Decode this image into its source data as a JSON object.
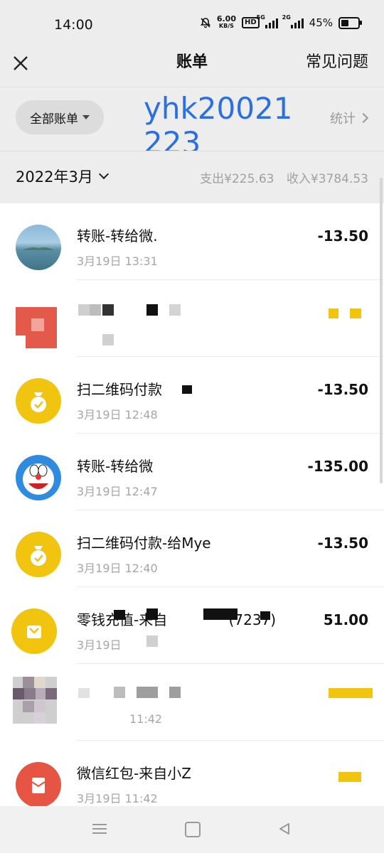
{
  "status": {
    "time": "14:00",
    "speed_value": "6.00",
    "speed_unit": "KB/S",
    "hd": "HD",
    "net1": "5G",
    "net2": "2G",
    "battery": "45%",
    "battery_level": 0.45
  },
  "nav": {
    "title": "账单",
    "faq": "常见问题",
    "close_icon": "close-icon"
  },
  "filter": {
    "all_bills": "全部账单",
    "watermark_line1": "yhk20021",
    "watermark_line2": "223",
    "stats": "统计"
  },
  "month": {
    "label": "2022年3月",
    "expense": "支出¥225.63",
    "income": "收入¥3784.53"
  },
  "transactions": [
    {
      "title": "转账-转给微.",
      "time": "3月19日 13:31",
      "amount": "-13.50",
      "avatar": "sea-photo"
    },
    {
      "title": "",
      "time": "",
      "amount": "",
      "avatar": "pixelated-red"
    },
    {
      "title": "扫二维码付款",
      "time": "3月19日 12:48",
      "amount": "-13.50",
      "avatar": "money-bag-icon"
    },
    {
      "title": "转账-转给微",
      "time": "3月19日 12:47",
      "amount": "-135.00",
      "avatar": "doraemon-photo"
    },
    {
      "title": "扫二维码付款-给Mye",
      "time": "3月19日 12:40",
      "amount": "-13.50",
      "avatar": "money-bag-icon"
    },
    {
      "title": "零钱充值-来自",
      "title_suffix": "(7237)",
      "time": "3月19日",
      "amount": "51.00",
      "avatar": "wallet-icon"
    },
    {
      "title": "",
      "time": "11:42",
      "amount": "",
      "avatar": "pixelated"
    },
    {
      "title": "微信红包-来自小Z",
      "time": "3月19日 11:42",
      "amount": "",
      "avatar": "red-packet-icon"
    }
  ],
  "colors": {
    "accent_yellow": "#f1c40f",
    "watermark_blue": "#2b6fe0",
    "red_packet": "#e65444"
  }
}
